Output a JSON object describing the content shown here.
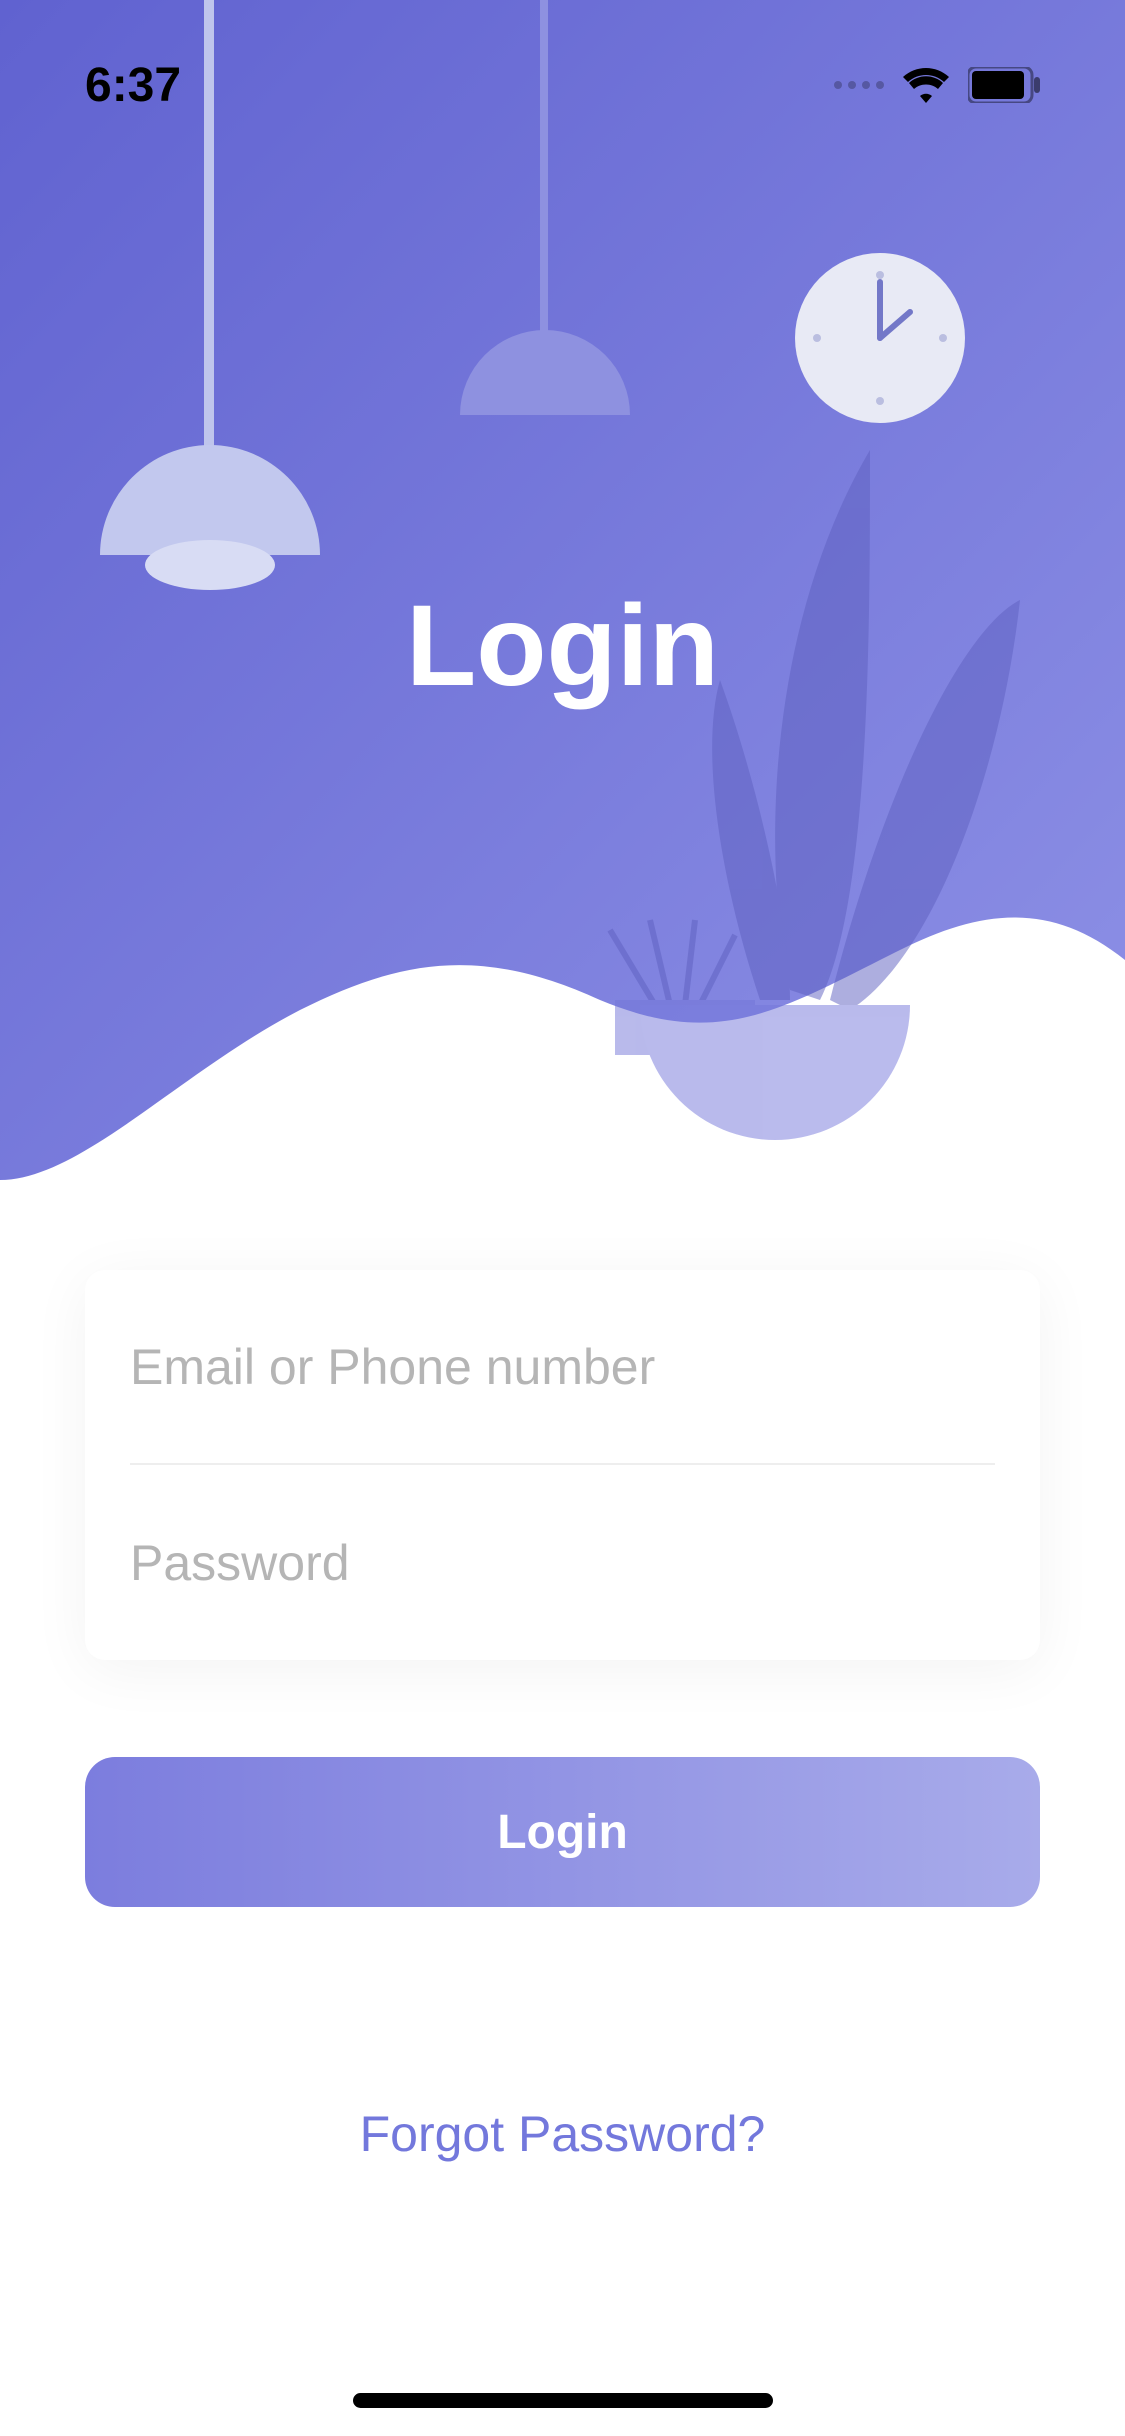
{
  "status_bar": {
    "time": "6:37"
  },
  "page": {
    "title": "Login"
  },
  "form": {
    "email_placeholder": "Email or Phone number",
    "password_placeholder": "Password"
  },
  "buttons": {
    "login": "Login"
  },
  "links": {
    "forgot_password": "Forgot Password?"
  },
  "colors": {
    "primary_gradient_start": "#6062D0",
    "primary_gradient_end": "#8A8DE3",
    "button_gradient_start": "#7C7DDE",
    "button_gradient_end": "#A8ABEA",
    "link": "#7378DC"
  }
}
